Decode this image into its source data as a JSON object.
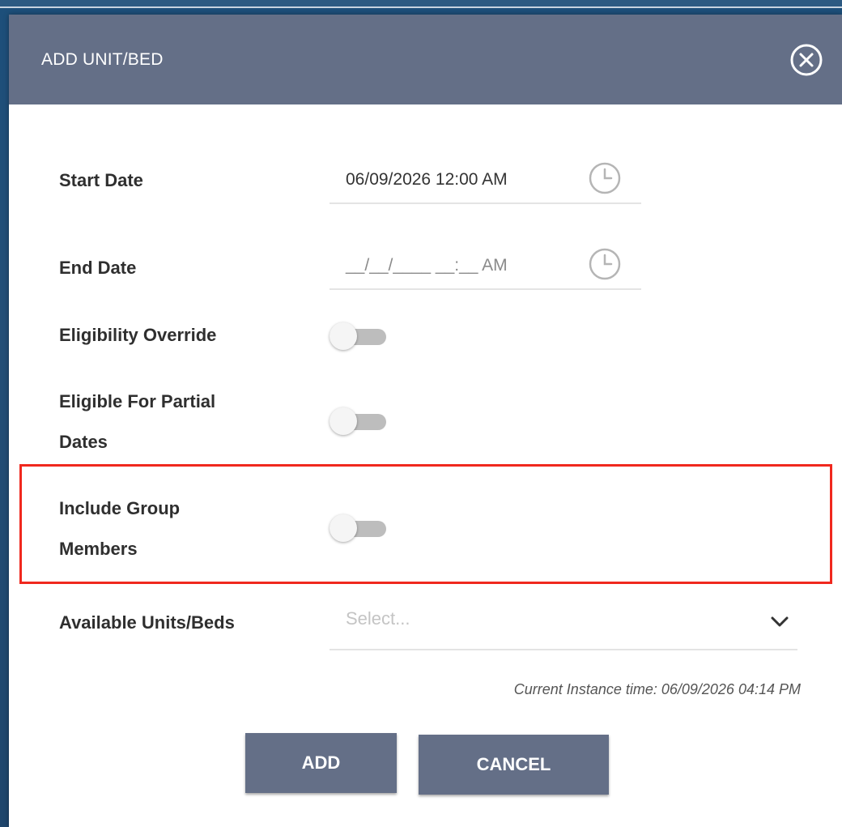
{
  "dialog": {
    "title": "ADD UNIT/BED",
    "close_icon": "close-circle-icon"
  },
  "form": {
    "start_date": {
      "label": "Start Date",
      "value": "06/09/2026 12:00 AM",
      "icon": "clock-icon"
    },
    "end_date": {
      "label": "End Date",
      "value": "__/__/____ __:__ AM",
      "icon": "clock-icon"
    },
    "eligibility_override": {
      "label": "Eligibility Override",
      "on": false
    },
    "eligible_partial_dates": {
      "label_line1": "Eligible For Partial",
      "label_line2": "Dates",
      "on": false
    },
    "include_group_members": {
      "label_line1": "Include Group",
      "label_line2": "Members",
      "on": false,
      "highlight_color": "#f0281e"
    },
    "available_units": {
      "label": "Available Units/Beds",
      "placeholder": "Select...",
      "icon": "chevron-down-icon"
    }
  },
  "instance_time": "Current Instance time: 06/09/2026 04:14 PM",
  "buttons": {
    "add": "ADD",
    "cancel": "CANCEL"
  },
  "colors": {
    "header": "#646f87",
    "button": "#646f87",
    "backdrop": "#1d4f7a",
    "toggle_off_track": "#bdbdbd"
  }
}
